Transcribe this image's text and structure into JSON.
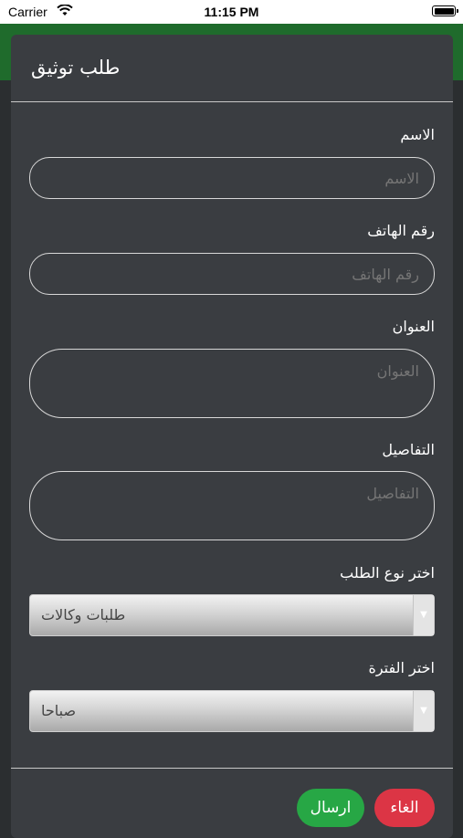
{
  "status_bar": {
    "carrier": "Carrier",
    "time": "11:15 PM"
  },
  "dialog": {
    "title": "طلب توثيق",
    "fields": {
      "name": {
        "label": "الاسم",
        "placeholder": "الاسم"
      },
      "phone": {
        "label": "رقم الهاتف",
        "placeholder": "رقم الهاتف"
      },
      "address": {
        "label": "العنوان",
        "placeholder": "العنوان"
      },
      "details": {
        "label": "التفاصيل",
        "placeholder": "التفاصيل"
      }
    },
    "request_type": {
      "label": "اختر نوع الطلب",
      "value": "طلبات وكالات"
    },
    "period": {
      "label": "اختر الفترة",
      "value": "صباحا"
    },
    "buttons": {
      "send": "ارسال",
      "cancel": "الغاء"
    }
  },
  "colors": {
    "header_green": "#1f6b2c",
    "dialog_bg": "#3a3d41",
    "send_green": "#27a745",
    "cancel_red": "#dc3545"
  }
}
